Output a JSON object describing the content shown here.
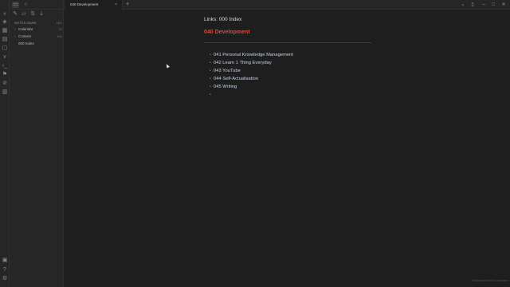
{
  "window": {
    "tab_title": "040 Development",
    "close_glyph": "×",
    "new_tab_glyph": "+"
  },
  "sidebar": {
    "vault_name": "NOTES-BANK",
    "vault_count": "161",
    "items": [
      {
        "label": "Calendar",
        "count": "27"
      },
      {
        "label": "Content",
        "count": "101"
      },
      {
        "label": "000 Index",
        "count": ""
      }
    ]
  },
  "note": {
    "links_line": "Links: 000 Index",
    "heading": "040 Development",
    "list": [
      "041 Personal Knowledge Management",
      "042 Learn 1 Thing Everyday",
      "043 YouTube",
      "044 Self-Actualisation",
      "045 Writing",
      ""
    ]
  },
  "status": {
    "text": "0 backlinks   0 words   0 characters"
  },
  "colors": {
    "accent_heading": "#e2423a",
    "background": "#1e1e1e",
    "panel": "#262626"
  },
  "icons": {
    "ribbon": [
      "collapse-icon",
      "tag-icon",
      "calendar-icon",
      "calendar-grid-icon",
      "template-icon",
      "file-icon",
      "graph-icon",
      "command-icon",
      "bookmark-icon",
      "publish-icon",
      "dictionary-icon"
    ],
    "ribbon_bottom": [
      "vault-icon",
      "help-icon",
      "settings-icon"
    ]
  }
}
